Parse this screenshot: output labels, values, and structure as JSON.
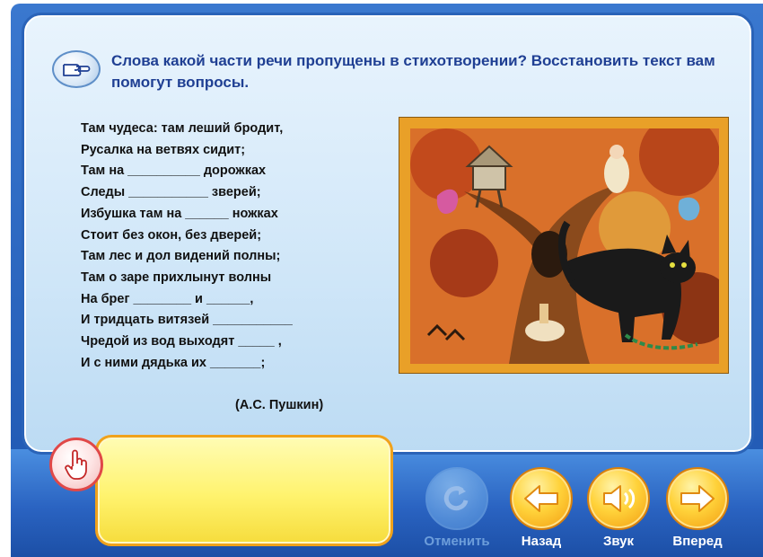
{
  "question": "Слова какой части речи пропущены в стихотворении? Восстановить текст вам помогут вопросы.",
  "poem": {
    "lines": [
      "Там чудеса: там леший бродит,",
      "Русалка на ветвях сидит;",
      "Там на __________ дорожках",
      "Следы ___________ зверей;",
      "Избушка там на ______ ножках",
      "Стоит без окон, без дверей;",
      "Там лес и дол видений полны;",
      "Там о заре прихлынут волны",
      "На брег ________ и ______,",
      "И тридцать витязей ___________",
      "Чредой из вод выходят _____ ,",
      "И с ними дядька их _______;"
    ],
    "author": "(А.С. Пушкин)"
  },
  "illustration": {
    "icon": "fairy-tale-cat-oak-illustration",
    "frame_color": "#e9a028"
  },
  "answer_box": {
    "text": "",
    "hint_icon": "hand-pointing-up-icon"
  },
  "buttons": {
    "cancel": {
      "label": "Отменить",
      "icon": "undo-icon",
      "enabled": false
    },
    "back": {
      "label": "Назад",
      "icon": "arrow-left-icon",
      "enabled": true
    },
    "sound": {
      "label": "Звук",
      "icon": "speaker-icon",
      "enabled": true
    },
    "forward": {
      "label": "Вперед",
      "icon": "arrow-right-icon",
      "enabled": true
    }
  },
  "colors": {
    "question_text": "#1f3f93",
    "panel_border": "#2a63b8",
    "button_yellow": "#ffd23a",
    "answer_box": "#fff36e"
  }
}
